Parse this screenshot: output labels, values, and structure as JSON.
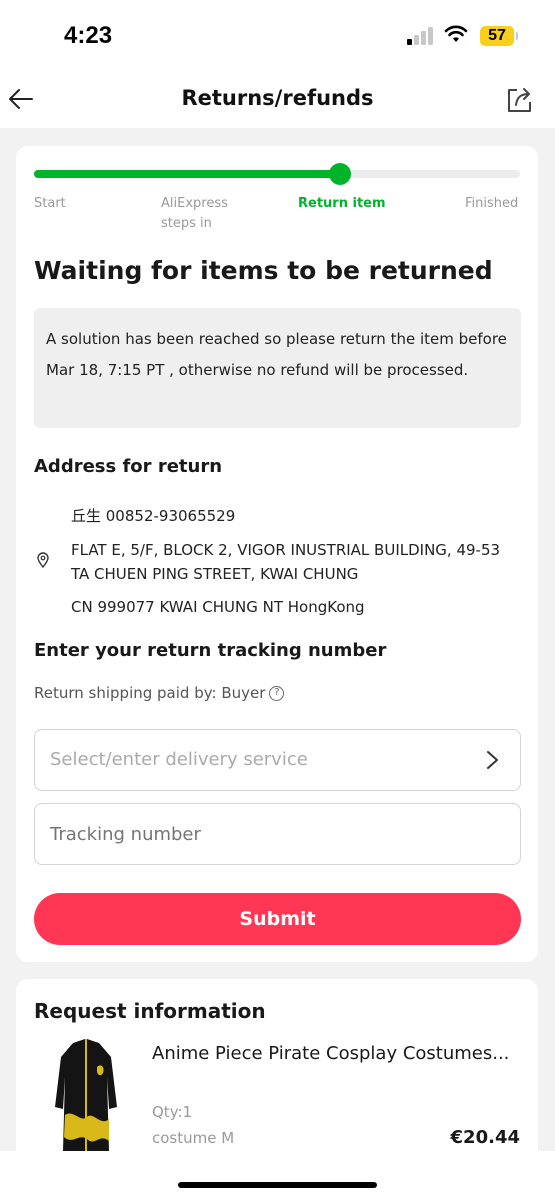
{
  "status": {
    "time": "4:23",
    "battery": "57"
  },
  "nav": {
    "title": "Returns/refunds",
    "back_icon": "arrow-left-icon",
    "share_icon": "share-icon"
  },
  "progress": {
    "steps": [
      {
        "label": "Start",
        "active": false
      },
      {
        "label": "AliExpress\nsteps in",
        "active": false
      },
      {
        "label": "Return item",
        "active": true
      },
      {
        "label": "Finished",
        "active": false
      }
    ],
    "fill_fraction": 0.63,
    "accent": "#00b42a"
  },
  "status_heading": "Waiting for items to be returned",
  "notice": "A solution has been reached so please return the item before Mar 18, 7:15 PT , otherwise no refund will be processed.",
  "address": {
    "heading": "Address for return",
    "name_phone": "丘生 00852-93065529",
    "line1": "FLAT E, 5/F, BLOCK 2, VIGOR INUSTRIAL BUILDING, 49-53",
    "line2": "TA CHUEN PING STREET, KWAI CHUNG",
    "line3": "CN 999077 KWAI CHUNG NT HongKong"
  },
  "tracking": {
    "heading": "Enter your return tracking number",
    "paid_by": "Return shipping paid by: Buyer",
    "delivery_placeholder": "Select/enter delivery service",
    "tracking_placeholder": "Tracking number",
    "submit_label": "Submit"
  },
  "request": {
    "heading": "Request information",
    "product_title": "Anime Piece Pirate Cosplay Costumes...",
    "qty": "Qty:1",
    "variant": "costume M",
    "price": "€20.44"
  },
  "colors": {
    "primary": "#ff3654",
    "success": "#00b42a",
    "notice_bg": "#efefef"
  }
}
